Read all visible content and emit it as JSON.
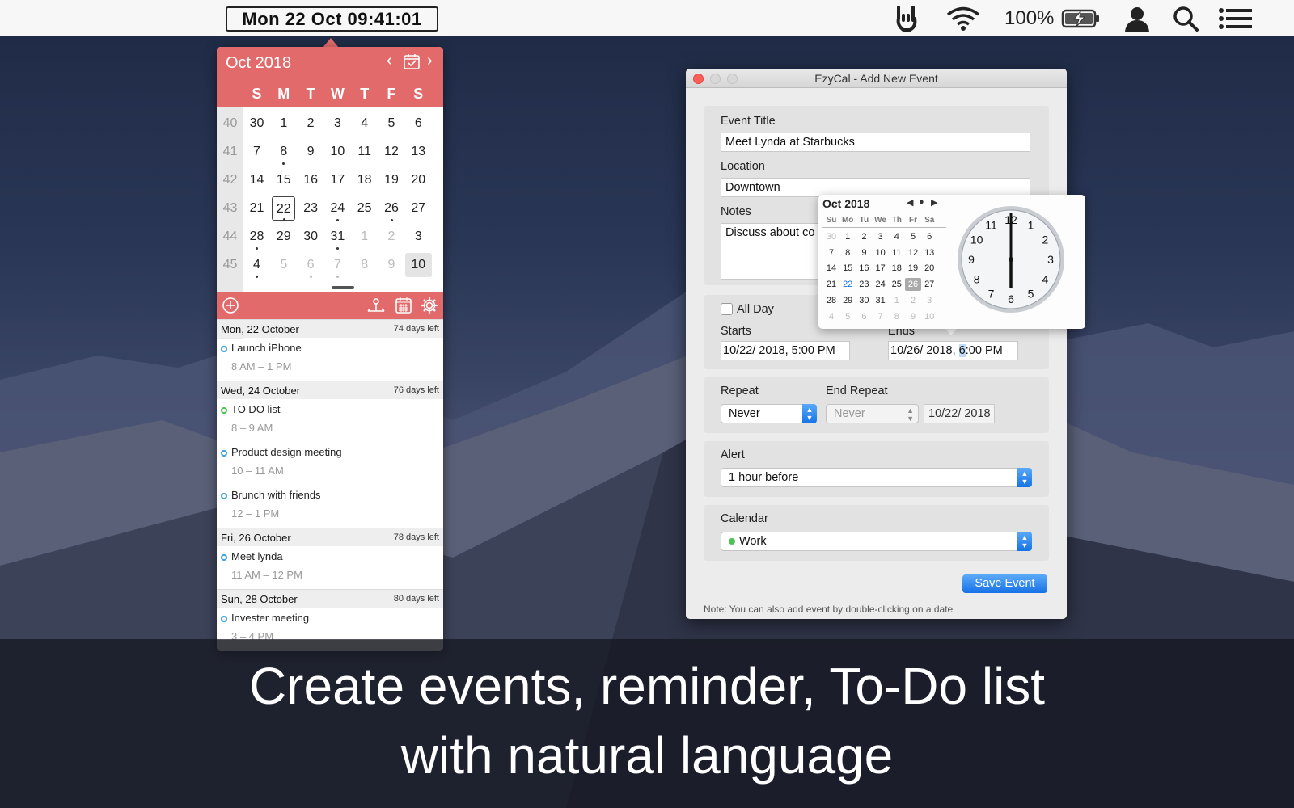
{
  "menubar": {
    "clock": "Mon 22 Oct 09:41:01",
    "battery": "100%"
  },
  "calendar": {
    "month_label": "Oct 2018",
    "dow": [
      "S",
      "M",
      "T",
      "W",
      "T",
      "F",
      "S"
    ],
    "weeks": [
      {
        "num": "40",
        "days": [
          {
            "d": "30"
          },
          {
            "d": "1"
          },
          {
            "d": "2"
          },
          {
            "d": "3"
          },
          {
            "d": "4"
          },
          {
            "d": "5"
          },
          {
            "d": "6"
          }
        ]
      },
      {
        "num": "41",
        "days": [
          {
            "d": "7"
          },
          {
            "d": "8",
            "dot": true
          },
          {
            "d": "9"
          },
          {
            "d": "10"
          },
          {
            "d": "11"
          },
          {
            "d": "12"
          },
          {
            "d": "13"
          }
        ]
      },
      {
        "num": "42",
        "days": [
          {
            "d": "14"
          },
          {
            "d": "15"
          },
          {
            "d": "16"
          },
          {
            "d": "17"
          },
          {
            "d": "18"
          },
          {
            "d": "19"
          },
          {
            "d": "20"
          }
        ]
      },
      {
        "num": "43",
        "days": [
          {
            "d": "21"
          },
          {
            "d": "22",
            "dot": true,
            "today": true
          },
          {
            "d": "23"
          },
          {
            "d": "24",
            "dot": true
          },
          {
            "d": "25"
          },
          {
            "d": "26",
            "dot": true
          },
          {
            "d": "27"
          }
        ]
      },
      {
        "num": "44",
        "days": [
          {
            "d": "28",
            "dot": true
          },
          {
            "d": "29"
          },
          {
            "d": "30"
          },
          {
            "d": "31",
            "dot": true
          },
          {
            "d": "1",
            "dim": true
          },
          {
            "d": "2",
            "dim": true
          },
          {
            "d": "3"
          }
        ]
      },
      {
        "num": "45",
        "days": [
          {
            "d": "4",
            "dot": true
          },
          {
            "d": "5",
            "dim": true
          },
          {
            "d": "6",
            "dim": true,
            "dot": true
          },
          {
            "d": "7",
            "dim": true,
            "dot": true
          },
          {
            "d": "8",
            "dim": true
          },
          {
            "d": "9",
            "dim": true
          },
          {
            "d": "10",
            "sel": true
          }
        ]
      }
    ]
  },
  "agenda": [
    {
      "date": "Mon, 22 October",
      "left": "74 days left",
      "events": [
        {
          "title": "Launch iPhone",
          "time": "8 AM – 1 PM",
          "color": "blue"
        }
      ]
    },
    {
      "date": "Wed, 24 October",
      "left": "76 days left",
      "events": [
        {
          "title": "TO DO list",
          "time": "8 – 9 AM",
          "color": "green"
        },
        {
          "title": "Product design meeting",
          "time": "10 – 11 AM",
          "color": "blue"
        },
        {
          "title": "Brunch with friends",
          "time": "12 – 1 PM",
          "color": "blue"
        }
      ]
    },
    {
      "date": "Fri, 26 October",
      "left": "78 days left",
      "events": [
        {
          "title": "Meet lynda",
          "time": "11 AM – 12 PM",
          "color": "blue"
        }
      ]
    },
    {
      "date": "Sun, 28 October",
      "left": "80 days left",
      "events": [
        {
          "title": "Invester meeting",
          "time": "3 – 4 PM",
          "color": "blue"
        }
      ]
    }
  ],
  "event_window": {
    "title": "EzyCal - Add New Event",
    "event_title_label": "Event Title",
    "event_title_value": "Meet Lynda at Starbucks",
    "location_label": "Location",
    "location_value": "Downtown",
    "notes_label": "Notes",
    "notes_value": "Discuss about co",
    "all_day_label": "All Day",
    "starts_label": "Starts",
    "starts_value": "10/22/ 2018,   5:00 PM",
    "ends_label": "Ends",
    "ends_value_date": "10/26/ 2018,   ",
    "ends_value_hour": "6",
    "ends_value_min": ":00",
    "ends_value_ampm": " PM",
    "repeat_label": "Repeat",
    "repeat_value": "Never",
    "end_repeat_label": "End Repeat",
    "end_repeat_value": "Never",
    "end_repeat_date": "10/22/ 2018",
    "alert_label": "Alert",
    "alert_value": "1 hour before",
    "calendar_label": "Calendar",
    "calendar_value": "Work",
    "save_label": "Save Event",
    "note": "Note: You can also add event by double-clicking on a date"
  },
  "mini_cal": {
    "month_label": "Oct 2018",
    "dow": [
      "Su",
      "Mo",
      "Tu",
      "We",
      "Th",
      "Fr",
      "Sa"
    ],
    "rows": [
      [
        {
          "d": "30",
          "dim": true
        },
        {
          "d": "1"
        },
        {
          "d": "2"
        },
        {
          "d": "3"
        },
        {
          "d": "4"
        },
        {
          "d": "5"
        },
        {
          "d": "6"
        }
      ],
      [
        {
          "d": "7"
        },
        {
          "d": "8"
        },
        {
          "d": "9"
        },
        {
          "d": "10"
        },
        {
          "d": "11"
        },
        {
          "d": "12"
        },
        {
          "d": "13"
        }
      ],
      [
        {
          "d": "14"
        },
        {
          "d": "15"
        },
        {
          "d": "16"
        },
        {
          "d": "17"
        },
        {
          "d": "18"
        },
        {
          "d": "19"
        },
        {
          "d": "20"
        }
      ],
      [
        {
          "d": "21"
        },
        {
          "d": "22",
          "today": true
        },
        {
          "d": "23"
        },
        {
          "d": "24"
        },
        {
          "d": "25"
        },
        {
          "d": "26",
          "sel": true
        },
        {
          "d": "27"
        }
      ],
      [
        {
          "d": "28"
        },
        {
          "d": "29"
        },
        {
          "d": "30"
        },
        {
          "d": "31"
        },
        {
          "d": "1",
          "dim": true
        },
        {
          "d": "2",
          "dim": true
        },
        {
          "d": "3",
          "dim": true
        }
      ],
      [
        {
          "d": "4",
          "dim": true
        },
        {
          "d": "5",
          "dim": true
        },
        {
          "d": "6",
          "dim": true
        },
        {
          "d": "7",
          "dim": true
        },
        {
          "d": "8",
          "dim": true
        },
        {
          "d": "9",
          "dim": true
        },
        {
          "d": "10",
          "dim": true
        }
      ]
    ],
    "clock_numbers": [
      "12",
      "1",
      "2",
      "3",
      "4",
      "5",
      "6",
      "7",
      "8",
      "9",
      "10",
      "11"
    ]
  },
  "caption": {
    "line1": "Create events, reminder, To-Do list",
    "line2": "with natural language"
  },
  "colors": {
    "accent": "#e26a6b",
    "blue_dot": "#3aa3e0",
    "green_dot": "#4cc254",
    "button_blue": "#1771e6"
  }
}
